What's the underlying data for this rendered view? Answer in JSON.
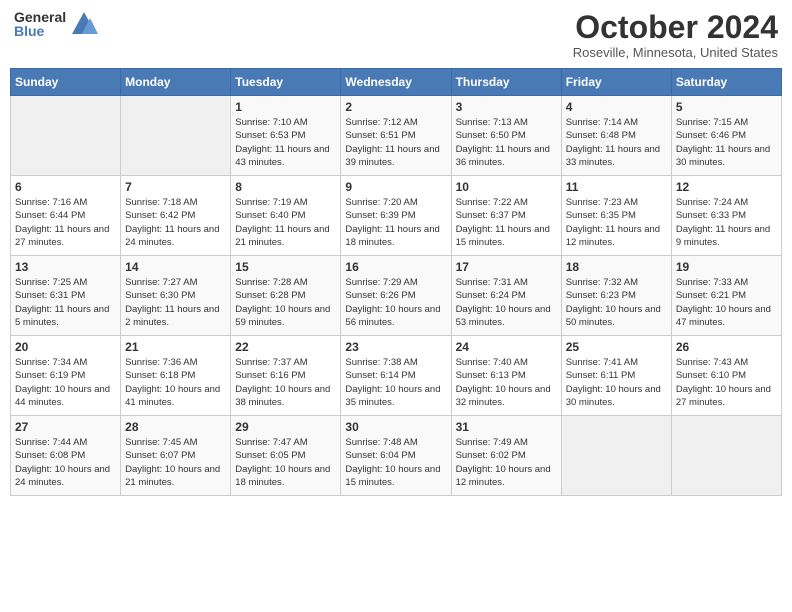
{
  "header": {
    "logo_general": "General",
    "logo_blue": "Blue",
    "title": "October 2024",
    "location": "Roseville, Minnesota, United States"
  },
  "days_of_week": [
    "Sunday",
    "Monday",
    "Tuesday",
    "Wednesday",
    "Thursday",
    "Friday",
    "Saturday"
  ],
  "weeks": [
    [
      {
        "day": "",
        "info": ""
      },
      {
        "day": "",
        "info": ""
      },
      {
        "day": "1",
        "info": "Sunrise: 7:10 AM\nSunset: 6:53 PM\nDaylight: 11 hours and 43 minutes."
      },
      {
        "day": "2",
        "info": "Sunrise: 7:12 AM\nSunset: 6:51 PM\nDaylight: 11 hours and 39 minutes."
      },
      {
        "day": "3",
        "info": "Sunrise: 7:13 AM\nSunset: 6:50 PM\nDaylight: 11 hours and 36 minutes."
      },
      {
        "day": "4",
        "info": "Sunrise: 7:14 AM\nSunset: 6:48 PM\nDaylight: 11 hours and 33 minutes."
      },
      {
        "day": "5",
        "info": "Sunrise: 7:15 AM\nSunset: 6:46 PM\nDaylight: 11 hours and 30 minutes."
      }
    ],
    [
      {
        "day": "6",
        "info": "Sunrise: 7:16 AM\nSunset: 6:44 PM\nDaylight: 11 hours and 27 minutes."
      },
      {
        "day": "7",
        "info": "Sunrise: 7:18 AM\nSunset: 6:42 PM\nDaylight: 11 hours and 24 minutes."
      },
      {
        "day": "8",
        "info": "Sunrise: 7:19 AM\nSunset: 6:40 PM\nDaylight: 11 hours and 21 minutes."
      },
      {
        "day": "9",
        "info": "Sunrise: 7:20 AM\nSunset: 6:39 PM\nDaylight: 11 hours and 18 minutes."
      },
      {
        "day": "10",
        "info": "Sunrise: 7:22 AM\nSunset: 6:37 PM\nDaylight: 11 hours and 15 minutes."
      },
      {
        "day": "11",
        "info": "Sunrise: 7:23 AM\nSunset: 6:35 PM\nDaylight: 11 hours and 12 minutes."
      },
      {
        "day": "12",
        "info": "Sunrise: 7:24 AM\nSunset: 6:33 PM\nDaylight: 11 hours and 9 minutes."
      }
    ],
    [
      {
        "day": "13",
        "info": "Sunrise: 7:25 AM\nSunset: 6:31 PM\nDaylight: 11 hours and 5 minutes."
      },
      {
        "day": "14",
        "info": "Sunrise: 7:27 AM\nSunset: 6:30 PM\nDaylight: 11 hours and 2 minutes."
      },
      {
        "day": "15",
        "info": "Sunrise: 7:28 AM\nSunset: 6:28 PM\nDaylight: 10 hours and 59 minutes."
      },
      {
        "day": "16",
        "info": "Sunrise: 7:29 AM\nSunset: 6:26 PM\nDaylight: 10 hours and 56 minutes."
      },
      {
        "day": "17",
        "info": "Sunrise: 7:31 AM\nSunset: 6:24 PM\nDaylight: 10 hours and 53 minutes."
      },
      {
        "day": "18",
        "info": "Sunrise: 7:32 AM\nSunset: 6:23 PM\nDaylight: 10 hours and 50 minutes."
      },
      {
        "day": "19",
        "info": "Sunrise: 7:33 AM\nSunset: 6:21 PM\nDaylight: 10 hours and 47 minutes."
      }
    ],
    [
      {
        "day": "20",
        "info": "Sunrise: 7:34 AM\nSunset: 6:19 PM\nDaylight: 10 hours and 44 minutes."
      },
      {
        "day": "21",
        "info": "Sunrise: 7:36 AM\nSunset: 6:18 PM\nDaylight: 10 hours and 41 minutes."
      },
      {
        "day": "22",
        "info": "Sunrise: 7:37 AM\nSunset: 6:16 PM\nDaylight: 10 hours and 38 minutes."
      },
      {
        "day": "23",
        "info": "Sunrise: 7:38 AM\nSunset: 6:14 PM\nDaylight: 10 hours and 35 minutes."
      },
      {
        "day": "24",
        "info": "Sunrise: 7:40 AM\nSunset: 6:13 PM\nDaylight: 10 hours and 32 minutes."
      },
      {
        "day": "25",
        "info": "Sunrise: 7:41 AM\nSunset: 6:11 PM\nDaylight: 10 hours and 30 minutes."
      },
      {
        "day": "26",
        "info": "Sunrise: 7:43 AM\nSunset: 6:10 PM\nDaylight: 10 hours and 27 minutes."
      }
    ],
    [
      {
        "day": "27",
        "info": "Sunrise: 7:44 AM\nSunset: 6:08 PM\nDaylight: 10 hours and 24 minutes."
      },
      {
        "day": "28",
        "info": "Sunrise: 7:45 AM\nSunset: 6:07 PM\nDaylight: 10 hours and 21 minutes."
      },
      {
        "day": "29",
        "info": "Sunrise: 7:47 AM\nSunset: 6:05 PM\nDaylight: 10 hours and 18 minutes."
      },
      {
        "day": "30",
        "info": "Sunrise: 7:48 AM\nSunset: 6:04 PM\nDaylight: 10 hours and 15 minutes."
      },
      {
        "day": "31",
        "info": "Sunrise: 7:49 AM\nSunset: 6:02 PM\nDaylight: 10 hours and 12 minutes."
      },
      {
        "day": "",
        "info": ""
      },
      {
        "day": "",
        "info": ""
      }
    ]
  ]
}
